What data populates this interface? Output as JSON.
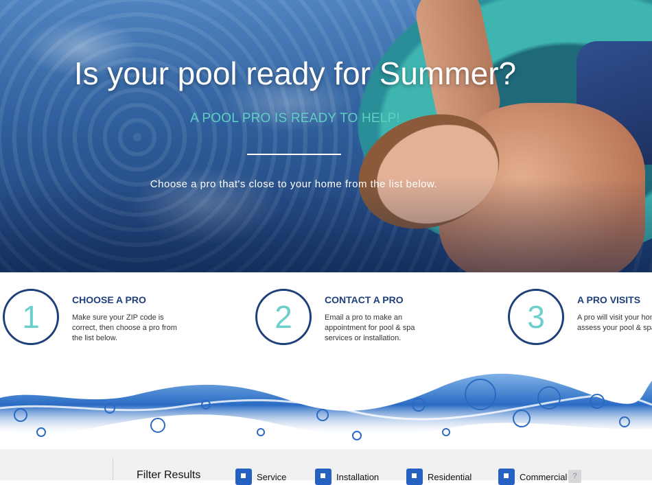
{
  "hero": {
    "title": "Is your pool ready for Summer?",
    "subtitle": "A POOL PRO IS READY TO HELP!",
    "instruction": "Choose a pro that's close to your home from the list below."
  },
  "steps": [
    {
      "number": "1",
      "title": "CHOOSE A PRO",
      "description": "Make sure your ZIP code is correct, then choose a pro from the list below."
    },
    {
      "number": "2",
      "title": "CONTACT A PRO",
      "description": "Email a pro to make an appointment for pool & spa services or installation."
    },
    {
      "number": "3",
      "title": "A PRO VISITS",
      "description": "A pro will visit your home to assess your pool & spa needs."
    }
  ],
  "filter": {
    "title": "Filter Results",
    "options": [
      {
        "label": "Service"
      },
      {
        "label": "Installation"
      },
      {
        "label": "Residential"
      },
      {
        "label": "Commercial"
      }
    ],
    "help": "?"
  },
  "colors": {
    "navy": "#1e3f7a",
    "teal": "#6ccfcc",
    "checkbox_blue": "#2461c0"
  }
}
